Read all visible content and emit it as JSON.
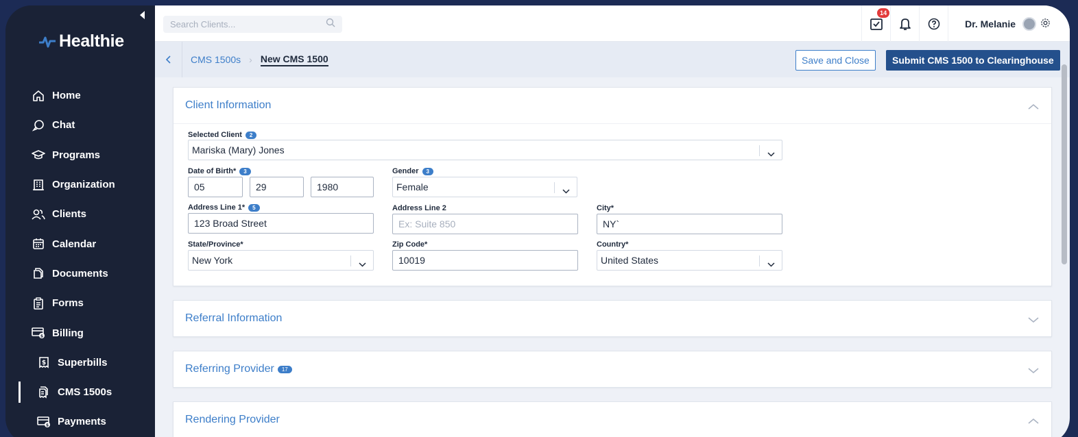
{
  "brand": {
    "name": "Healthie"
  },
  "sidebar": {
    "items": [
      {
        "label": "Home",
        "icon": "home-icon"
      },
      {
        "label": "Chat",
        "icon": "chat-icon"
      },
      {
        "label": "Programs",
        "icon": "graduation-cap-icon"
      },
      {
        "label": "Organization",
        "icon": "building-icon"
      },
      {
        "label": "Clients",
        "icon": "users-icon"
      },
      {
        "label": "Calendar",
        "icon": "calendar-icon"
      },
      {
        "label": "Documents",
        "icon": "documents-icon"
      },
      {
        "label": "Forms",
        "icon": "clipboard-icon"
      },
      {
        "label": "Billing",
        "icon": "billing-icon"
      },
      {
        "label": "Superbills",
        "icon": "receipt-dollar-icon"
      },
      {
        "label": "CMS 1500s",
        "icon": "receipt-icon",
        "active": true
      },
      {
        "label": "Payments",
        "icon": "payments-icon"
      }
    ]
  },
  "topbar": {
    "search_placeholder": "Search Clients...",
    "tasks_badge": "14",
    "user_name": "Dr. Melanie"
  },
  "breadcrumb": {
    "parent": "CMS 1500s",
    "current": "New CMS 1500"
  },
  "actions": {
    "save_close": "Save and Close",
    "submit": "Submit CMS 1500 to Clearinghouse"
  },
  "sections": {
    "client": {
      "title": "Client Information",
      "selected_client_label": "Selected Client",
      "selected_client_badge": "2",
      "selected_client_value": "Mariska (Mary) Jones",
      "dob_label": "Date of Birth*",
      "dob_badge": "3",
      "dob_month": "05",
      "dob_day": "29",
      "dob_year": "1980",
      "gender_label": "Gender",
      "gender_badge": "3",
      "gender_value": "Female",
      "address1_label": "Address Line 1*",
      "address1_badge": "5",
      "address1_value": "123 Broad Street",
      "address2_label": "Address Line 2",
      "address2_placeholder": "Ex: Suite 850",
      "city_label": "City*",
      "city_value": "NY`",
      "state_label": "State/Province*",
      "state_value": "New York",
      "zip_label": "Zip Code*",
      "zip_value": "10019",
      "country_label": "Country*",
      "country_value": "United States"
    },
    "referral": {
      "title": "Referral Information"
    },
    "referring_provider": {
      "title": "Referring Provider",
      "badge": "17"
    },
    "rendering_provider": {
      "title": "Rendering Provider"
    }
  },
  "colors": {
    "accent": "#3d7ec9",
    "primary_button": "#24508c",
    "sidebar_bg": "#1a2236",
    "outer_bg": "#1c2b55",
    "badge_red": "#e23a3a"
  }
}
